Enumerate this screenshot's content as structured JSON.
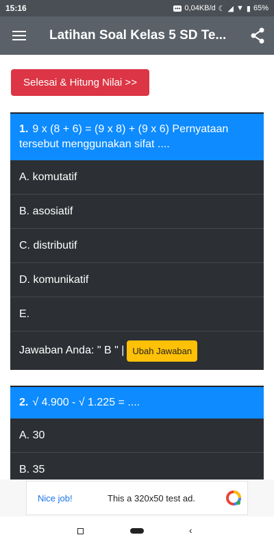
{
  "status": {
    "time": "15:16",
    "network": "0,04KB/d",
    "battery": "65%"
  },
  "appbar": {
    "title": "Latihan Soal Kelas 5 SD Te...",
    "menu_icon": "hamburger-icon",
    "share_icon": "share-icon"
  },
  "finish_button": "Selesai & Hitung Nilai >>",
  "questions": [
    {
      "number": "1.",
      "text": "9 x (8 + 6) = (9 x 8) + (9 x 6) Pernyataan tersebut menggunakan sifat ....",
      "options": [
        "A. komutatif",
        "B. asosiatif",
        "C. distributif",
        "D. komunikatif",
        "E."
      ],
      "answer_label": "Jawaban Anda: \" B \" |",
      "change_label": "Ubah Jawaban"
    },
    {
      "number": "2.",
      "text": "√ 4.900 - √ 1.225 = ....",
      "options": [
        "A. 30",
        "B. 35"
      ]
    }
  ],
  "ad": {
    "nice": "Nice job!",
    "text": "This a 320x50 test ad."
  },
  "colors": {
    "appbar": "#5a6168",
    "question_header": "#0d8bff",
    "option_bg": "#2c2f33",
    "finish_button": "#dc3545",
    "change_button": "#ffc107"
  }
}
